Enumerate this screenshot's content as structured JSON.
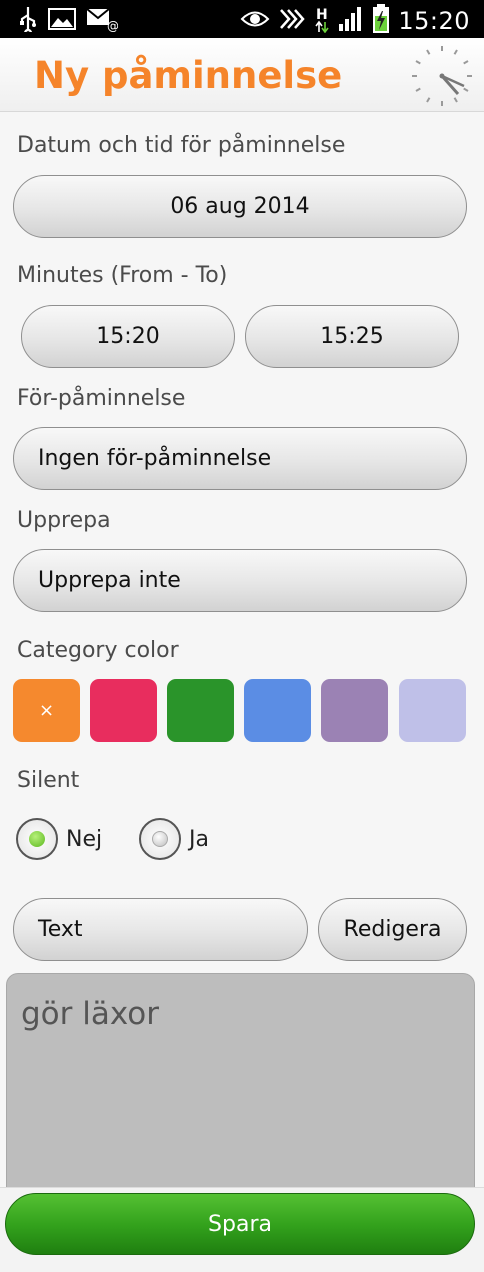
{
  "status_bar": {
    "time": "15:20",
    "left_icons": [
      "usb-icon",
      "image-icon",
      "mail-icon"
    ],
    "right_icons": [
      "eye-icon",
      "nfc-icon",
      "network-h-icon",
      "signal-icon",
      "battery-charging-icon"
    ]
  },
  "header": {
    "title": "Ny påminnelse",
    "icon": "clock-icon",
    "title_color": "#f5842a"
  },
  "datetime": {
    "label": "Datum och tid för påminnelse",
    "date": "06 aug 2014"
  },
  "minutes": {
    "label": "Minutes (From - To)",
    "from": "15:20",
    "to": "15:25"
  },
  "pre_reminder": {
    "label": "För-påminnelse",
    "value": "Ingen för-påminnelse"
  },
  "repeat": {
    "label": "Upprepa",
    "value": "Upprepa inte"
  },
  "category": {
    "label": "Category color",
    "selected_mark": "×",
    "colors": [
      "#f5892e",
      "#e82d5e",
      "#2a942a",
      "#5b8de4",
      "#9b82b4",
      "#bfc0e8"
    ]
  },
  "silent": {
    "label": "Silent",
    "options": [
      "Nej",
      "Ja"
    ],
    "selected": "Nej"
  },
  "text_section": {
    "type_value": "Text",
    "edit_label": "Redigera",
    "content": "gör läxor"
  },
  "footer": {
    "save_label": "Spara"
  }
}
